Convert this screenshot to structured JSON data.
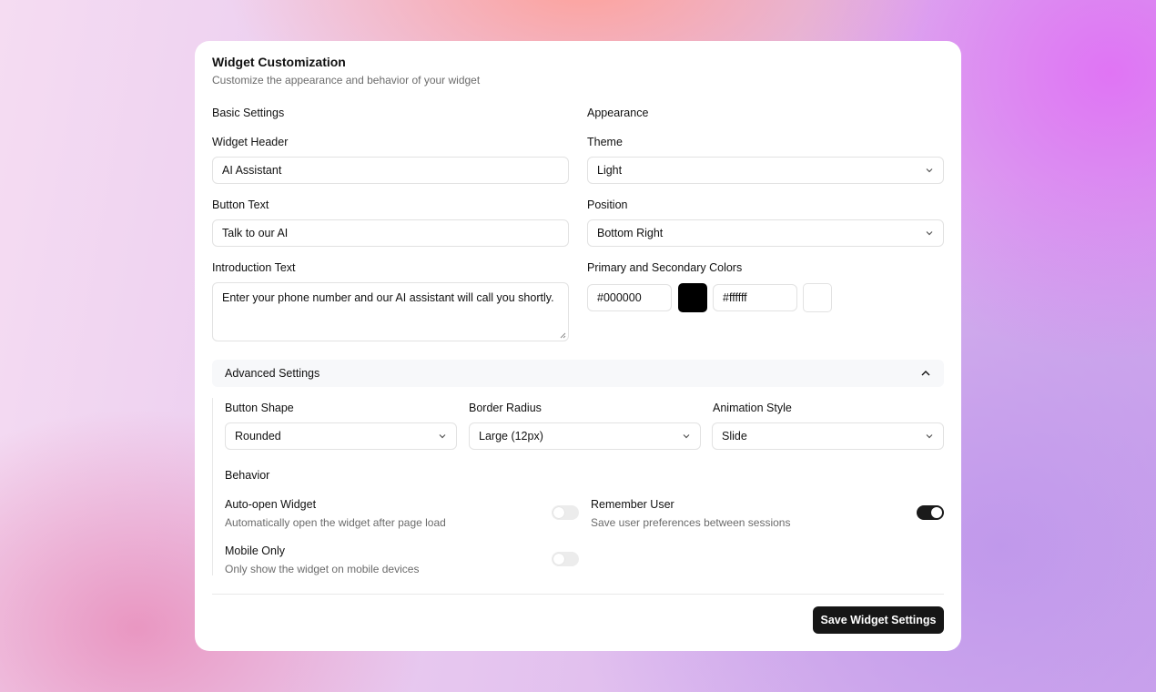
{
  "header": {
    "title": "Widget Customization",
    "subtitle": "Customize the appearance and behavior of your widget"
  },
  "basic": {
    "section_label": "Basic Settings",
    "widget_header": {
      "label": "Widget Header",
      "value": "AI Assistant"
    },
    "button_text": {
      "label": "Button Text",
      "value": "Talk to our AI"
    },
    "intro_text": {
      "label": "Introduction Text",
      "value": "Enter your phone number and our AI assistant will call you shortly."
    }
  },
  "appearance": {
    "section_label": "Appearance",
    "theme": {
      "label": "Theme",
      "value": "Light"
    },
    "position": {
      "label": "Position",
      "value": "Bottom Right"
    },
    "colors": {
      "label": "Primary and Secondary Colors",
      "primary": "#000000",
      "secondary": "#ffffff"
    }
  },
  "advanced": {
    "toggle_label": "Advanced Settings",
    "button_shape": {
      "label": "Button Shape",
      "value": "Rounded"
    },
    "border_radius": {
      "label": "Border Radius",
      "value": "Large (12px)"
    },
    "animation_style": {
      "label": "Animation Style",
      "value": "Slide"
    },
    "behavior": {
      "section_label": "Behavior",
      "auto_open": {
        "title": "Auto-open Widget",
        "description": "Automatically open the widget after page load",
        "enabled": false
      },
      "remember_user": {
        "title": "Remember User",
        "description": "Save user preferences between sessions",
        "enabled": true
      },
      "mobile_only": {
        "title": "Mobile Only",
        "description": "Only show the widget on mobile devices",
        "enabled": false
      }
    }
  },
  "actions": {
    "save_label": "Save Widget Settings"
  },
  "icons": {
    "select": "chevron-down-icon",
    "collapse": "chevron-up-icon"
  }
}
